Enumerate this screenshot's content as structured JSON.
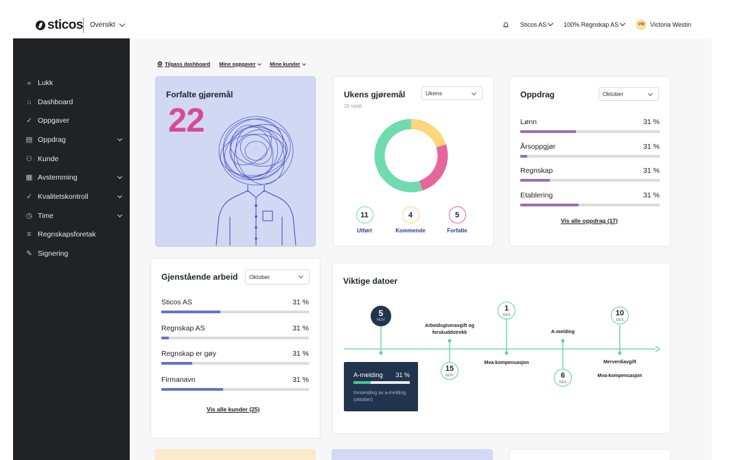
{
  "topbar": {
    "logo_text": "sticos",
    "section": "Oversikt",
    "company": "Sticos AS",
    "client": "100% Regnskap AS",
    "user_initials": "VW",
    "user_name": "Victoria Westin"
  },
  "sidebar": {
    "items": [
      {
        "label": "Lukk",
        "icon": "collapse-icon",
        "expandable": false
      },
      {
        "label": "Dashboard",
        "icon": "home-icon",
        "expandable": false
      },
      {
        "label": "Oppgaver",
        "icon": "check-icon",
        "expandable": false
      },
      {
        "label": "Oppdrag",
        "icon": "document-icon",
        "expandable": true
      },
      {
        "label": "Kunde",
        "icon": "users-icon",
        "expandable": false
      },
      {
        "label": "Avstemming",
        "icon": "table-icon",
        "expandable": true
      },
      {
        "label": "Kvalitetskontroll",
        "icon": "double-check-icon",
        "expandable": true
      },
      {
        "label": "Time",
        "icon": "clock-icon",
        "expandable": true
      },
      {
        "label": "Regnskapsforetak",
        "icon": "list-icon",
        "expandable": false
      },
      {
        "label": "Signering",
        "icon": "sign-icon",
        "expandable": false
      }
    ]
  },
  "filters": {
    "customize": "Tilpass dashboard",
    "my_tasks": "Mine oppgaver",
    "my_customers": "Mine kunder"
  },
  "forfalte": {
    "title": "Forfalte gjøremål",
    "count": "22"
  },
  "ukens": {
    "title": "Ukens gjøremål",
    "select": "Ukens",
    "total": "20 totalt",
    "colors": {
      "utfort": "#6fdcae",
      "kommende": "#fcd77c",
      "forfalte": "#e6659b"
    },
    "stats": [
      {
        "value": "11",
        "label": "Utført",
        "color": "#6fdcae"
      },
      {
        "value": "4",
        "label": "Kommende",
        "color": "#fcd77c"
      },
      {
        "value": "5",
        "label": "Forfalte",
        "color": "#e6659b"
      }
    ]
  },
  "oppdrag": {
    "title": "Oppdrag",
    "select": "Oktober",
    "rows": [
      {
        "name": "Lønn",
        "pct": "31 %",
        "fill": 0.4
      },
      {
        "name": "Årsoppgjør",
        "pct": "31 %",
        "fill": 0.05
      },
      {
        "name": "Regnskap",
        "pct": "31 %",
        "fill": 0.21
      },
      {
        "name": "Etablering",
        "pct": "31 %",
        "fill": 0.42
      }
    ],
    "bar_color": "#9a6cbc",
    "link": "Vis alle oppdrag (17)"
  },
  "gjenstaende": {
    "title": "Gjenstående arbeid",
    "select": "Oktober",
    "rows": [
      {
        "name": "Sticos AS",
        "pct": "31 %",
        "fill": 0.4
      },
      {
        "name": "Regnskap AS",
        "pct": "31 %",
        "fill": 0.05
      },
      {
        "name": "Regnskap er gøy",
        "pct": "31 %",
        "fill": 0.21
      },
      {
        "name": "Firmanavn",
        "pct": "31 %",
        "fill": 0.42
      }
    ],
    "bar_color": "#6572cf",
    "link": "Vis alle kunder (25)"
  },
  "viktige": {
    "title": "Viktige datoer",
    "dates": [
      {
        "day": "5",
        "month": "NOV"
      },
      {
        "day": "15",
        "month": "NOV"
      },
      {
        "day": "1",
        "month": "DES"
      },
      {
        "day": "6",
        "month": "DES"
      },
      {
        "day": "10",
        "month": "DES"
      }
    ],
    "labels": {
      "arbeidsgiver": "Arbeidsgiveravgift og forskuddstrekk",
      "mva1": "Mva-kompensasjon",
      "amelding": "A-melding",
      "merverdi": "Merverdiavgift",
      "mva2": "Mva-kompensasjon"
    },
    "tooltip": {
      "title": "A-melding",
      "pct": "31 %",
      "fill": 0.31,
      "desc": "Innsending av a-melding (oktober)"
    }
  }
}
